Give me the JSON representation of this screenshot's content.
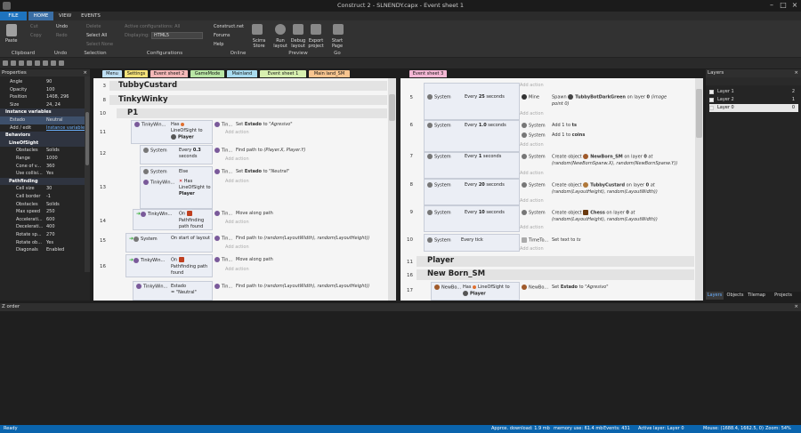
{
  "window": {
    "title": "Construct 2 - SLNENDY.capx - Event sheet 1"
  },
  "menu_tabs": [
    "FILE",
    "HOME",
    "VIEW",
    "EVENTS"
  ],
  "ribbon": {
    "paste": "Paste",
    "cut": "Cut",
    "copy": "Copy",
    "undo": "Undo",
    "redo": "Redo",
    "delete": "Delete",
    "select_all": "Select All",
    "select_none": "Select None",
    "active_configs": "Active configurations: All",
    "displaying_label": "Displaying:",
    "displaying_value": "HTML5",
    "construct_net": "Construct.net",
    "forums": "Forums",
    "help": "Help",
    "scirra_store": "Scirra Store",
    "run_layout": "Run layout",
    "debug_layout": "Debug layout",
    "export_project": "Export project",
    "start_page": "Start Page",
    "groups": [
      "Clipboard",
      "Undo",
      "Selection",
      "Configurations",
      "Online",
      "Preview",
      "Go"
    ]
  },
  "properties": {
    "title": "Properties",
    "rows": [
      {
        "k": "Angle",
        "v": "90",
        "t": "p"
      },
      {
        "k": "Opacity",
        "v": "100",
        "t": "p"
      },
      {
        "k": "Position",
        "v": "1408, 296",
        "t": "p"
      },
      {
        "k": "Size",
        "v": "24, 24",
        "t": "p"
      },
      {
        "k": "Instance variables",
        "v": "",
        "t": "cat"
      },
      {
        "k": "Estado",
        "v": "Neutral",
        "t": "p"
      },
      {
        "k": "Add / edit",
        "v": "Instance variables",
        "t": "link"
      },
      {
        "k": "Behaviors",
        "v": "",
        "t": "cat"
      },
      {
        "k": "LineOfSight",
        "v": "",
        "t": "subcat"
      },
      {
        "k": "Obstacles",
        "v": "Solids",
        "t": "sub"
      },
      {
        "k": "Range",
        "v": "1000",
        "t": "sub"
      },
      {
        "k": "Cone of v...",
        "v": "360",
        "t": "sub"
      },
      {
        "k": "Use collisi...",
        "v": "Yes",
        "t": "sub"
      },
      {
        "k": "Pathfinding",
        "v": "",
        "t": "subcat"
      },
      {
        "k": "Cell size",
        "v": "30",
        "t": "sub"
      },
      {
        "k": "Cell border",
        "v": "-1",
        "t": "sub"
      },
      {
        "k": "Obstacles",
        "v": "Solids",
        "t": "sub"
      },
      {
        "k": "Max speed",
        "v": "250",
        "t": "sub"
      },
      {
        "k": "Accelerati...",
        "v": "600",
        "t": "sub"
      },
      {
        "k": "Decelerati...",
        "v": "400",
        "t": "sub"
      },
      {
        "k": "Rotate sp...",
        "v": "270",
        "t": "sub"
      },
      {
        "k": "Rotate ob...",
        "v": "Yes",
        "t": "sub"
      },
      {
        "k": "Diagonals",
        "v": "Enabled",
        "t": "sub"
      }
    ]
  },
  "left_tabs": [
    {
      "label": "Menu",
      "color": "#bfe0f5"
    },
    {
      "label": "Settings",
      "color": "#f7e37a"
    },
    {
      "label": "Event sheet 2",
      "color": "#f5b8b8"
    },
    {
      "label": "GameMode",
      "color": "#b9e6a5"
    },
    {
      "label": "Mainland",
      "color": "#a9dcf0"
    },
    {
      "label": "Event sheet 1",
      "color": "#d8f0b0"
    },
    {
      "label": "Main land_SM",
      "color": "#f8c590"
    }
  ],
  "right_tab": {
    "label": "Event sheet 3",
    "color": "#f5b8d5"
  },
  "left_sheet": {
    "groups": {
      "g3": "TubbyCustard",
      "g8": "TinkyWinky",
      "g10": "P1"
    },
    "lines": [
      "3",
      "8",
      "10",
      "11",
      "12",
      "13",
      "14",
      "15",
      "16"
    ],
    "e11": {
      "obj": "TinkyWin...",
      "c1": "Has",
      "c2": "LineOfSight to",
      "c3": "Player",
      "aobj": "Tin...",
      "a1": "Set",
      "a2": "Estado",
      "a3": "to",
      "a4": "\"Agresivo\""
    },
    "e12": {
      "obj": "System",
      "cond": "Every",
      "val": "0.3",
      "unit": "seconds",
      "aobj": "Tin...",
      "act": "Find path to",
      "expr": "(Player.X, Player.Y)"
    },
    "e13": {
      "obj": "System",
      "c1": "Else",
      "obj2": "TinkyWin...",
      "c2": "Has",
      "c3": "LineOfSight to",
      "c4": "Player",
      "aobj": "Tin...",
      "a1": "Set",
      "a2": "Estado",
      "a3": "to",
      "a4": "\"Neutral\""
    },
    "e14": {
      "obj": "TinkyWin...",
      "c1": "On",
      "c2": "Pathfinding path found",
      "aobj": "Tin...",
      "act": "Move along path"
    },
    "e15": {
      "obj": "System",
      "cond": "On start of layout",
      "aobj": "Tin...",
      "act": "Find path to",
      "expr": "(random(LayoutWidth), random(LayoutHeight))"
    },
    "e16": {
      "obj": "TinkyWin...",
      "c1": "On",
      "c2": "Pathfinding path found",
      "aobj": "Tin...",
      "act": "Move along path"
    },
    "e17": {
      "obj": "TinkyWin...",
      "c1": "Estado",
      "c2": "= \"Neutral\"",
      "aobj": "Tin...",
      "act": "Find path to",
      "expr": "(random(LayoutWidth), random(LayoutHeight))"
    },
    "add_action": "Add action"
  },
  "right_sheet": {
    "lines": [
      "5",
      "6",
      "7",
      "8",
      "9",
      "10",
      "11",
      "16",
      "17"
    ],
    "e5": {
      "obj": "System",
      "cond": "Every",
      "val": "25",
      "unit": "seconds",
      "aobj": "Mine",
      "a1": "Spawn",
      "a2": "TubbyBotDarkGreen",
      "a3": "on layer",
      "a4": "0",
      "a5": "(image point 0)"
    },
    "e6": {
      "obj": "System",
      "cond": "Every",
      "val": "1.0",
      "unit": "seconds",
      "a1o": "System",
      "a1": "Add 1 to",
      "a1v": "ts",
      "a2o": "System",
      "a2": "Add 1 to",
      "a2v": "coins"
    },
    "e7": {
      "obj": "System",
      "cond": "Every",
      "val": "1",
      "unit": "seconds",
      "aobj": "System",
      "a1": "Create object",
      "a2": "NewBorn_SM",
      "a3": "on layer",
      "a4": "0",
      "a5": "at (random(NewBornSpanw.X), random(NewBornSpanw.Y))"
    },
    "e8": {
      "obj": "System",
      "cond": "Every",
      "val": "20",
      "unit": "seconds",
      "aobj": "System",
      "a1": "Create object",
      "a2": "TubbyCustard",
      "a3": "on layer",
      "a4": "0",
      "a5": "at (random(LayoutHeight), random(LayoutWidth))"
    },
    "e9": {
      "obj": "System",
      "cond": "Every",
      "val": "10",
      "unit": "seconds",
      "aobj": "System",
      "a1": "Create object",
      "a2": "Chess",
      "a3": "on layer",
      "a4": "0",
      "a5": "at (random(LayoutHeight), random(LayoutWidth))"
    },
    "e10": {
      "obj": "System",
      "cond": "Every tick",
      "aobj": "TimeTo...",
      "a1": "Set text to",
      "a2": "ts"
    },
    "g11": "Player",
    "g16": "New Born_SM",
    "e17": {
      "obj": "NewBo...",
      "c1": "Has",
      "c2": "LineOfSight to",
      "c3": "Player",
      "aobj": "NewBo...",
      "a1": "Set",
      "a2": "Estado",
      "a3": "to",
      "a4": "\"Agresivo\""
    },
    "add_action": "Add action"
  },
  "layers": {
    "title": "Layers",
    "items": [
      {
        "name": "Layer 1",
        "num": "2"
      },
      {
        "name": "Layer 2",
        "num": "1"
      },
      {
        "name": "Layer 0",
        "num": "0"
      }
    ],
    "tabs": [
      "Layers",
      "Objects",
      "Tilemap",
      "Projects"
    ]
  },
  "zorder": {
    "title": "Z order"
  },
  "status": {
    "ready": "Ready",
    "download": "Approx. download: 1.9 mb",
    "memory": "memory use: 61.4 mb",
    "events": "Events: 431",
    "active_layer": "Active layer: Layer 0",
    "mouse": "Mouse: (1688.4, 1662.5, 0)",
    "zoom": "Zoom: 54%"
  },
  "colors": {
    "accent": "#1e73be",
    "status_bar": "#0a64ad",
    "sheet_bg": "#f5f5f5"
  }
}
